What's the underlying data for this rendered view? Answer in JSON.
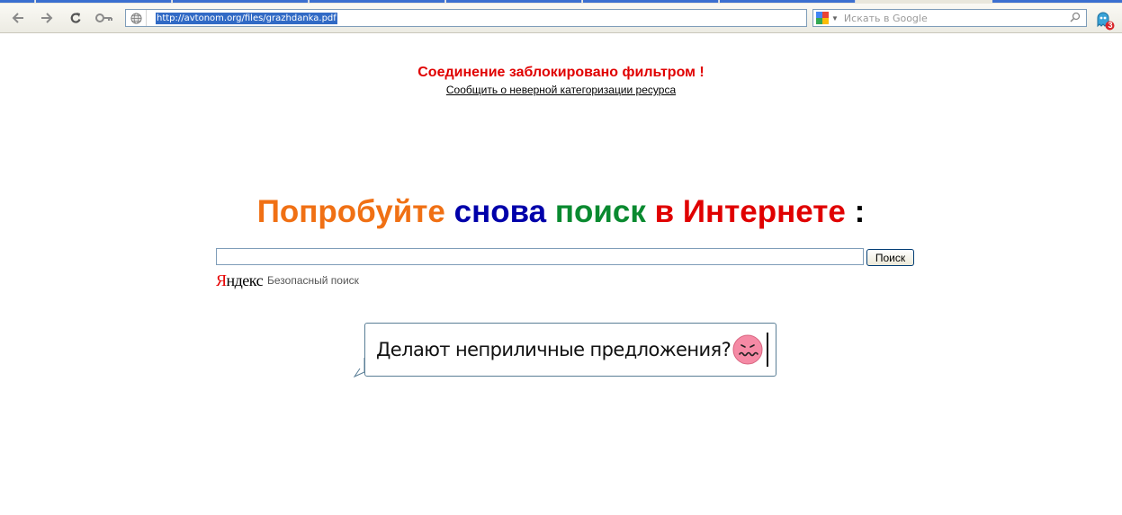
{
  "browser": {
    "url": "http://avtonom.org/files/grazhdanka.pdf",
    "search_placeholder": "Искать в Google",
    "extension_badge": "3"
  },
  "block": {
    "title": "Соединение заблокировано фильтром !",
    "report_link": "Сообщить о неверной категоризации ресурса"
  },
  "headline": {
    "word1": "Попробуйте",
    "word2": "снова",
    "word3": "поиск",
    "word4": "в Интернете",
    "colon": ":",
    "colors": {
      "word1": "#f07014",
      "word2": "#0000aa",
      "word3": "#0a8a30",
      "word4": "#e00000",
      "colon": "#000000"
    }
  },
  "search": {
    "input_value": "",
    "button_label": "Поиск",
    "logo_first": "Я",
    "logo_rest": "ндекс",
    "safe_label": "Безопасный поиск"
  },
  "banner": {
    "text": "Делают неприличные предложения?"
  }
}
